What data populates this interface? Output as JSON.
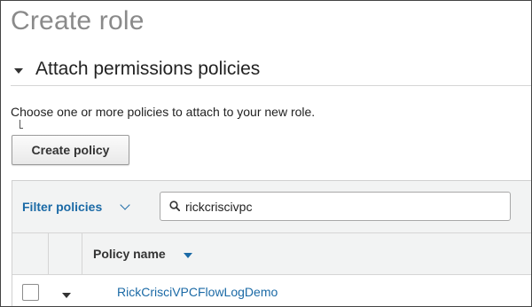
{
  "page": {
    "title": "Create role"
  },
  "section": {
    "title": "Attach permissions policies",
    "help_text": "Choose one or more policies to attach to your new role."
  },
  "toolbar": {
    "create_policy_label": "Create policy"
  },
  "filter": {
    "label": "Filter policies",
    "search_value": "rickcriscivpc"
  },
  "table": {
    "columns": [
      "Policy name"
    ],
    "rows": [
      {
        "policy_name": "RickCrisciVPCFlowLogDemo"
      }
    ]
  },
  "colors": {
    "link": "#1b6aa6",
    "title_gray": "#8a8a8a",
    "panel_bg": "#f2f3f3"
  },
  "icons": [
    "caret-down-icon",
    "chevron-down-icon",
    "search-icon",
    "sort-down-icon",
    "expand-caret-icon"
  ]
}
